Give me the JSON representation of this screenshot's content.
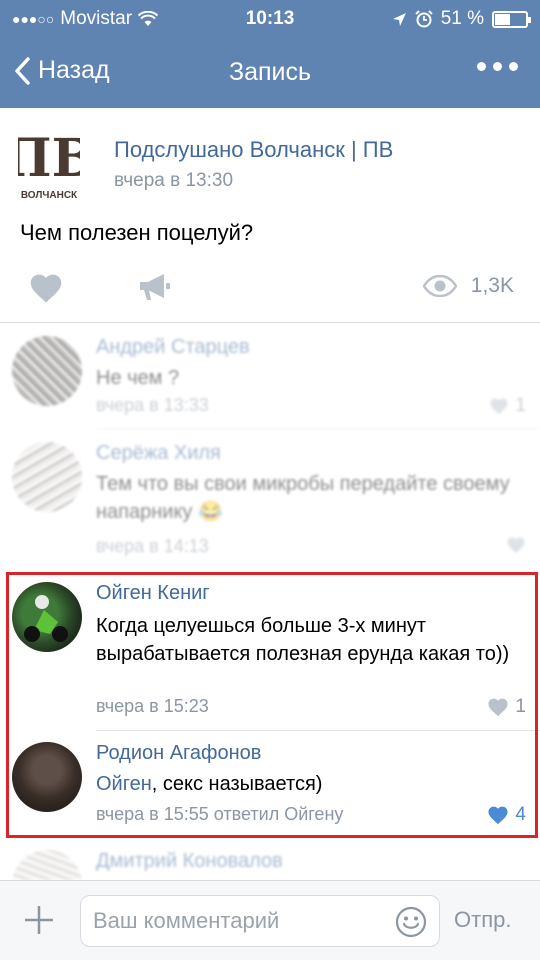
{
  "status": {
    "carrier": "Movistar",
    "time": "10:13",
    "battery": "51 %",
    "battery_level": 0.51
  },
  "nav": {
    "back_label": "Назад",
    "title": "Запись"
  },
  "post": {
    "group_name": "Подслушано Волчанск | ПВ",
    "time": "вчера в 13:30",
    "text": "Чем полезен поцелуй?",
    "avatar_text": "ВОЛЧАНСК",
    "views": "1,3K"
  },
  "comments": [
    {
      "author": "Андрей Старцев",
      "text": "Не чем ?",
      "meta": "вчера в 13:33",
      "likes": "1"
    },
    {
      "author": "Серёжа Хиля",
      "text": "Тем что вы свои микробы передайте своему напарнику 😂",
      "meta": "вчера в 14:13",
      "likes": ""
    },
    {
      "author": "Ойген Кениг",
      "text": "Когда целуешься больше 3-х минут вырабатывается полезная ерунда какая то))",
      "meta": "вчера в 15:23",
      "likes": "1"
    },
    {
      "author": "Родион Агафонов",
      "mention": "Ойген",
      "text": ", секс называется)",
      "meta": "вчера в 15:55 ответил Ойгену",
      "likes": "4"
    },
    {
      "author": "Дмитрий Коновалов"
    }
  ],
  "composer": {
    "placeholder": "Ваш комментарий",
    "send_label": "Отпр."
  },
  "colors": {
    "header": "#5f84b1",
    "link": "#41699b",
    "muted": "#8b96a3",
    "liked": "#4a8ad6",
    "highlight": "#d9242c"
  }
}
